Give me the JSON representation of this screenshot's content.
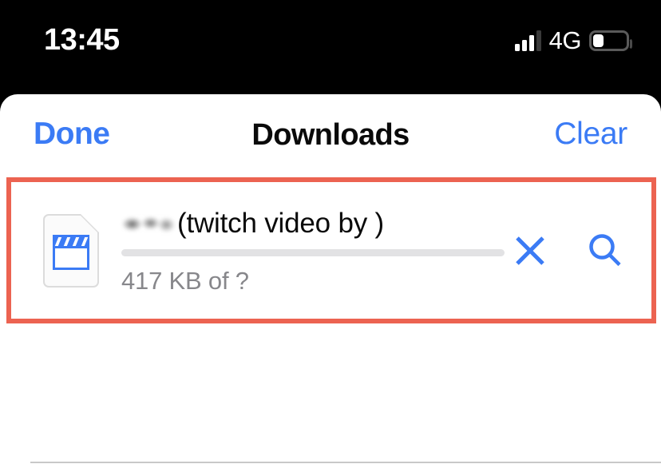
{
  "status_bar": {
    "time": "13:45",
    "network_type": "4G",
    "signal_bars_active": 3,
    "signal_bars_total": 4,
    "battery_level_percent": 32,
    "icons": {
      "signal": "cellular-signal-icon",
      "battery": "battery-icon"
    }
  },
  "sheet": {
    "title": "Downloads",
    "done_label": "Done",
    "clear_label": "Clear"
  },
  "download": {
    "file_type_icon": "video-file-icon",
    "redacted_name": "",
    "title": "(twitch video by )",
    "status": "417 KB of ?",
    "progress_percent": 0,
    "cancel_icon": "close-icon",
    "search_icon": "search-icon"
  },
  "annotation": {
    "highlight_color": "#ec6351"
  },
  "colors": {
    "accent_blue": "#3b7bf5",
    "title_black": "#0a0a0a",
    "status_gray": "#87878b",
    "track_gray": "#e2e2e4",
    "highlight_red": "#ec6351"
  }
}
